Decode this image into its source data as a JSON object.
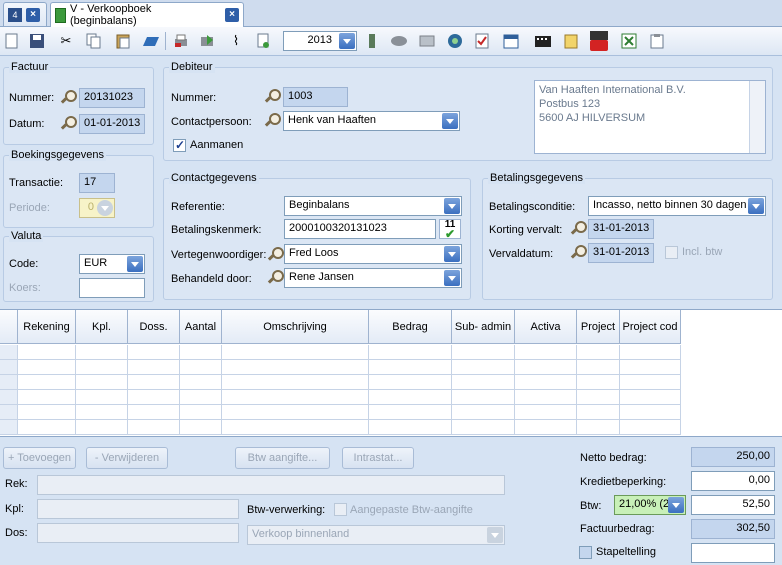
{
  "tabs": [
    {
      "label": ""
    },
    {
      "label": "V - Verkoopboek (beginbalans)"
    }
  ],
  "toolbar": {
    "year": "2013"
  },
  "factuur": {
    "title": "Factuur",
    "nummer_label": "Nummer:",
    "nummer": "20131023",
    "datum_label": "Datum:",
    "datum": "01-01-2013"
  },
  "boeking": {
    "title": "Boekingsgegevens",
    "transactie_label": "Transactie:",
    "transactie": "17",
    "periode_label": "Periode:",
    "periode": "0"
  },
  "valuta": {
    "title": "Valuta",
    "code_label": "Code:",
    "code": "EUR",
    "koers_label": "Koers:",
    "koers": ""
  },
  "debiteur": {
    "title": "Debiteur",
    "nummer_label": "Nummer:",
    "nummer": "1003",
    "contact_label": "Contactpersoon:",
    "contact": "Henk van Haaften",
    "aanmanen_label": "Aanmanen",
    "address": [
      "Van Haaften International B.V.",
      "Postbus 123",
      "5600 AJ  HILVERSUM"
    ]
  },
  "contact": {
    "title": "Contactgegevens",
    "referentie_label": "Referentie:",
    "referentie": "Beginbalans",
    "kenmerk_label": "Betalingskenmerk:",
    "kenmerk": "2000100320131023",
    "kenmerk_badge": "11",
    "vertegen_label": "Vertegenwoordiger:",
    "vertegen": "Fred Loos",
    "behandeld_label": "Behandeld door:",
    "behandeld": "Rene Jansen"
  },
  "betaling": {
    "title": "Betalingsgegevens",
    "conditie_label": "Betalingsconditie:",
    "conditie": "Incasso, netto binnen 30 dagen",
    "korting_label": "Korting vervalt:",
    "korting": "31-01-2013",
    "verval_label": "Vervaldatum:",
    "verval": "31-01-2013",
    "incl_btw_label": "Incl. btw"
  },
  "grid": {
    "columns": [
      "Rekening",
      "Kpl.",
      "Doss.",
      "Aantal",
      "Omschrijving",
      "Bedrag",
      "Sub- admin",
      "Activa",
      "Project",
      "Project cod"
    ]
  },
  "actions": {
    "toevoegen": "+ Toevoegen",
    "verwijderen": "- Verwijderen",
    "btw_aangifte": "Btw aangifte...",
    "intrastat": "Intrastat..."
  },
  "detail": {
    "rek_label": "Rek:",
    "kpl_label": "Kpl:",
    "dos_label": "Dos:",
    "btw_verwerking_label": "Btw-verwerking:",
    "aangepaste_label": "Aangepaste Btw-aangifte",
    "verwerking": "Verkoop binnenland"
  },
  "totals": {
    "netto_label": "Netto bedrag:",
    "netto": "250,00",
    "krediet_label": "Kredietbeperking:",
    "krediet": "0,00",
    "btw_label": "Btw:",
    "btw_code": "21,00% (2)",
    "btw": "52,50",
    "factuur_label": "Factuurbedrag:",
    "factuur": "302,50",
    "stapel_label": "Stapeltelling",
    "stapel": ""
  },
  "colors": {
    "accent": "#3b6fc0",
    "readonly": "#c4d6ee"
  }
}
